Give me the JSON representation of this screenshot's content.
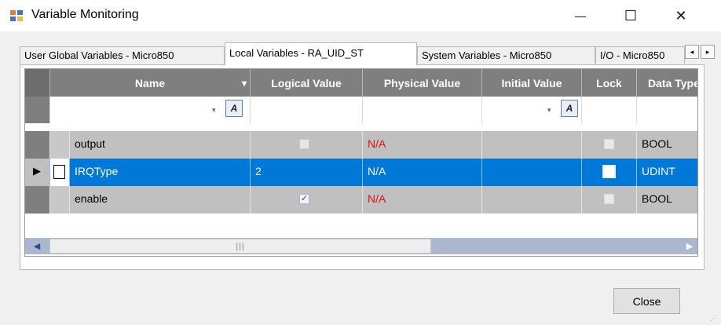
{
  "window": {
    "title": "Variable Monitoring",
    "app_icon": "variable-grid-icon",
    "minimize_glyph": "—",
    "maximize_glyph": "☐",
    "close_glyph": "✕"
  },
  "tabs": [
    {
      "label": "User Global Variables - Micro850",
      "active": false
    },
    {
      "label": "Local Variables - RA_UID_ST",
      "active": true
    },
    {
      "label": "System Variables - Micro850",
      "active": false
    },
    {
      "label": "I/O - Micro850",
      "active": false
    }
  ],
  "tab_scroll": {
    "left": "◂",
    "right": "▸"
  },
  "grid": {
    "columns": [
      "Name",
      "Logical Value",
      "Physical Value",
      "Initial Value",
      "Lock",
      "Data Type"
    ],
    "name_sort_glyph": "▾",
    "filter_glyph": "▾",
    "filter_button_glyph": "A",
    "rows": [
      {
        "name": "output",
        "logical": "",
        "logical_checkbox": "unchecked",
        "physical": "N/A",
        "initial": "",
        "lock": "unchecked",
        "data_type": "BOOL",
        "selected": false
      },
      {
        "name": "IRQType",
        "logical": "2",
        "logical_checkbox": "",
        "physical": "N/A",
        "initial": "",
        "lock": "unchecked",
        "data_type": "UDINT",
        "selected": true
      },
      {
        "name": "enable",
        "logical": "",
        "logical_checkbox": "checked",
        "physical": "N/A",
        "initial": "",
        "lock": "unchecked",
        "data_type": "BOOL",
        "selected": false
      }
    ],
    "row_pointer_glyph": "▶",
    "check_glyph": "✓"
  },
  "scrollbar": {
    "left_glyph": "◀",
    "right_glyph": "▶",
    "thumb_grip": "|||"
  },
  "footer": {
    "close_label": "Close",
    "grip_glyph": "⋰"
  },
  "colors": {
    "selection": "#0078d7",
    "na_text": "#e41010",
    "header_bg": "#7f7f7f",
    "readonly_row": "#c0c0c0"
  }
}
